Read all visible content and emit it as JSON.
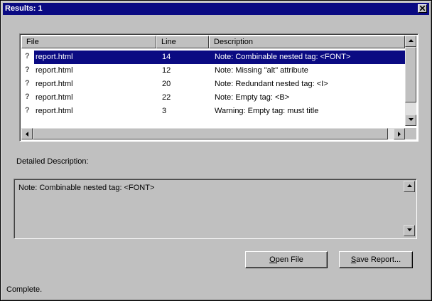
{
  "window": {
    "title": "Results: 1"
  },
  "list": {
    "columns": [
      "File",
      "Line",
      "Description"
    ],
    "rows": [
      {
        "icon": "?",
        "file": "report.html",
        "line": "14",
        "description": "Note: Combinable nested tag: <FONT>",
        "selected": true
      },
      {
        "icon": "?",
        "file": "report.html",
        "line": "12",
        "description": "Note: Missing \"alt\" attribute",
        "selected": false
      },
      {
        "icon": "?",
        "file": "report.html",
        "line": "20",
        "description": "Note: Redundant nested tag: <I>",
        "selected": false
      },
      {
        "icon": "?",
        "file": "report.html",
        "line": "22",
        "description": "Note: Empty tag: <B>",
        "selected": false
      },
      {
        "icon": "?",
        "file": "report.html",
        "line": "3",
        "description": "Warning: Empty tag: must title",
        "selected": false
      }
    ]
  },
  "detail": {
    "label": "Detailed Description:",
    "text": "Note: Combinable nested tag: <FONT>"
  },
  "buttons": {
    "open_file_mnemonic": "O",
    "open_file_rest": "pen File",
    "save_report_mnemonic": "S",
    "save_report_rest": "ave Report..."
  },
  "status": {
    "text": "Complete."
  },
  "icons": {
    "close": "close-icon",
    "scroll_up": "arrow-up-icon",
    "scroll_down": "arrow-down-icon",
    "scroll_left": "arrow-left-icon",
    "scroll_right": "arrow-right-icon",
    "row": "question-icon"
  },
  "colors": {
    "titlebar": "#0a0a82",
    "selection": "#0a0a82",
    "face": "#c0c0c0"
  }
}
